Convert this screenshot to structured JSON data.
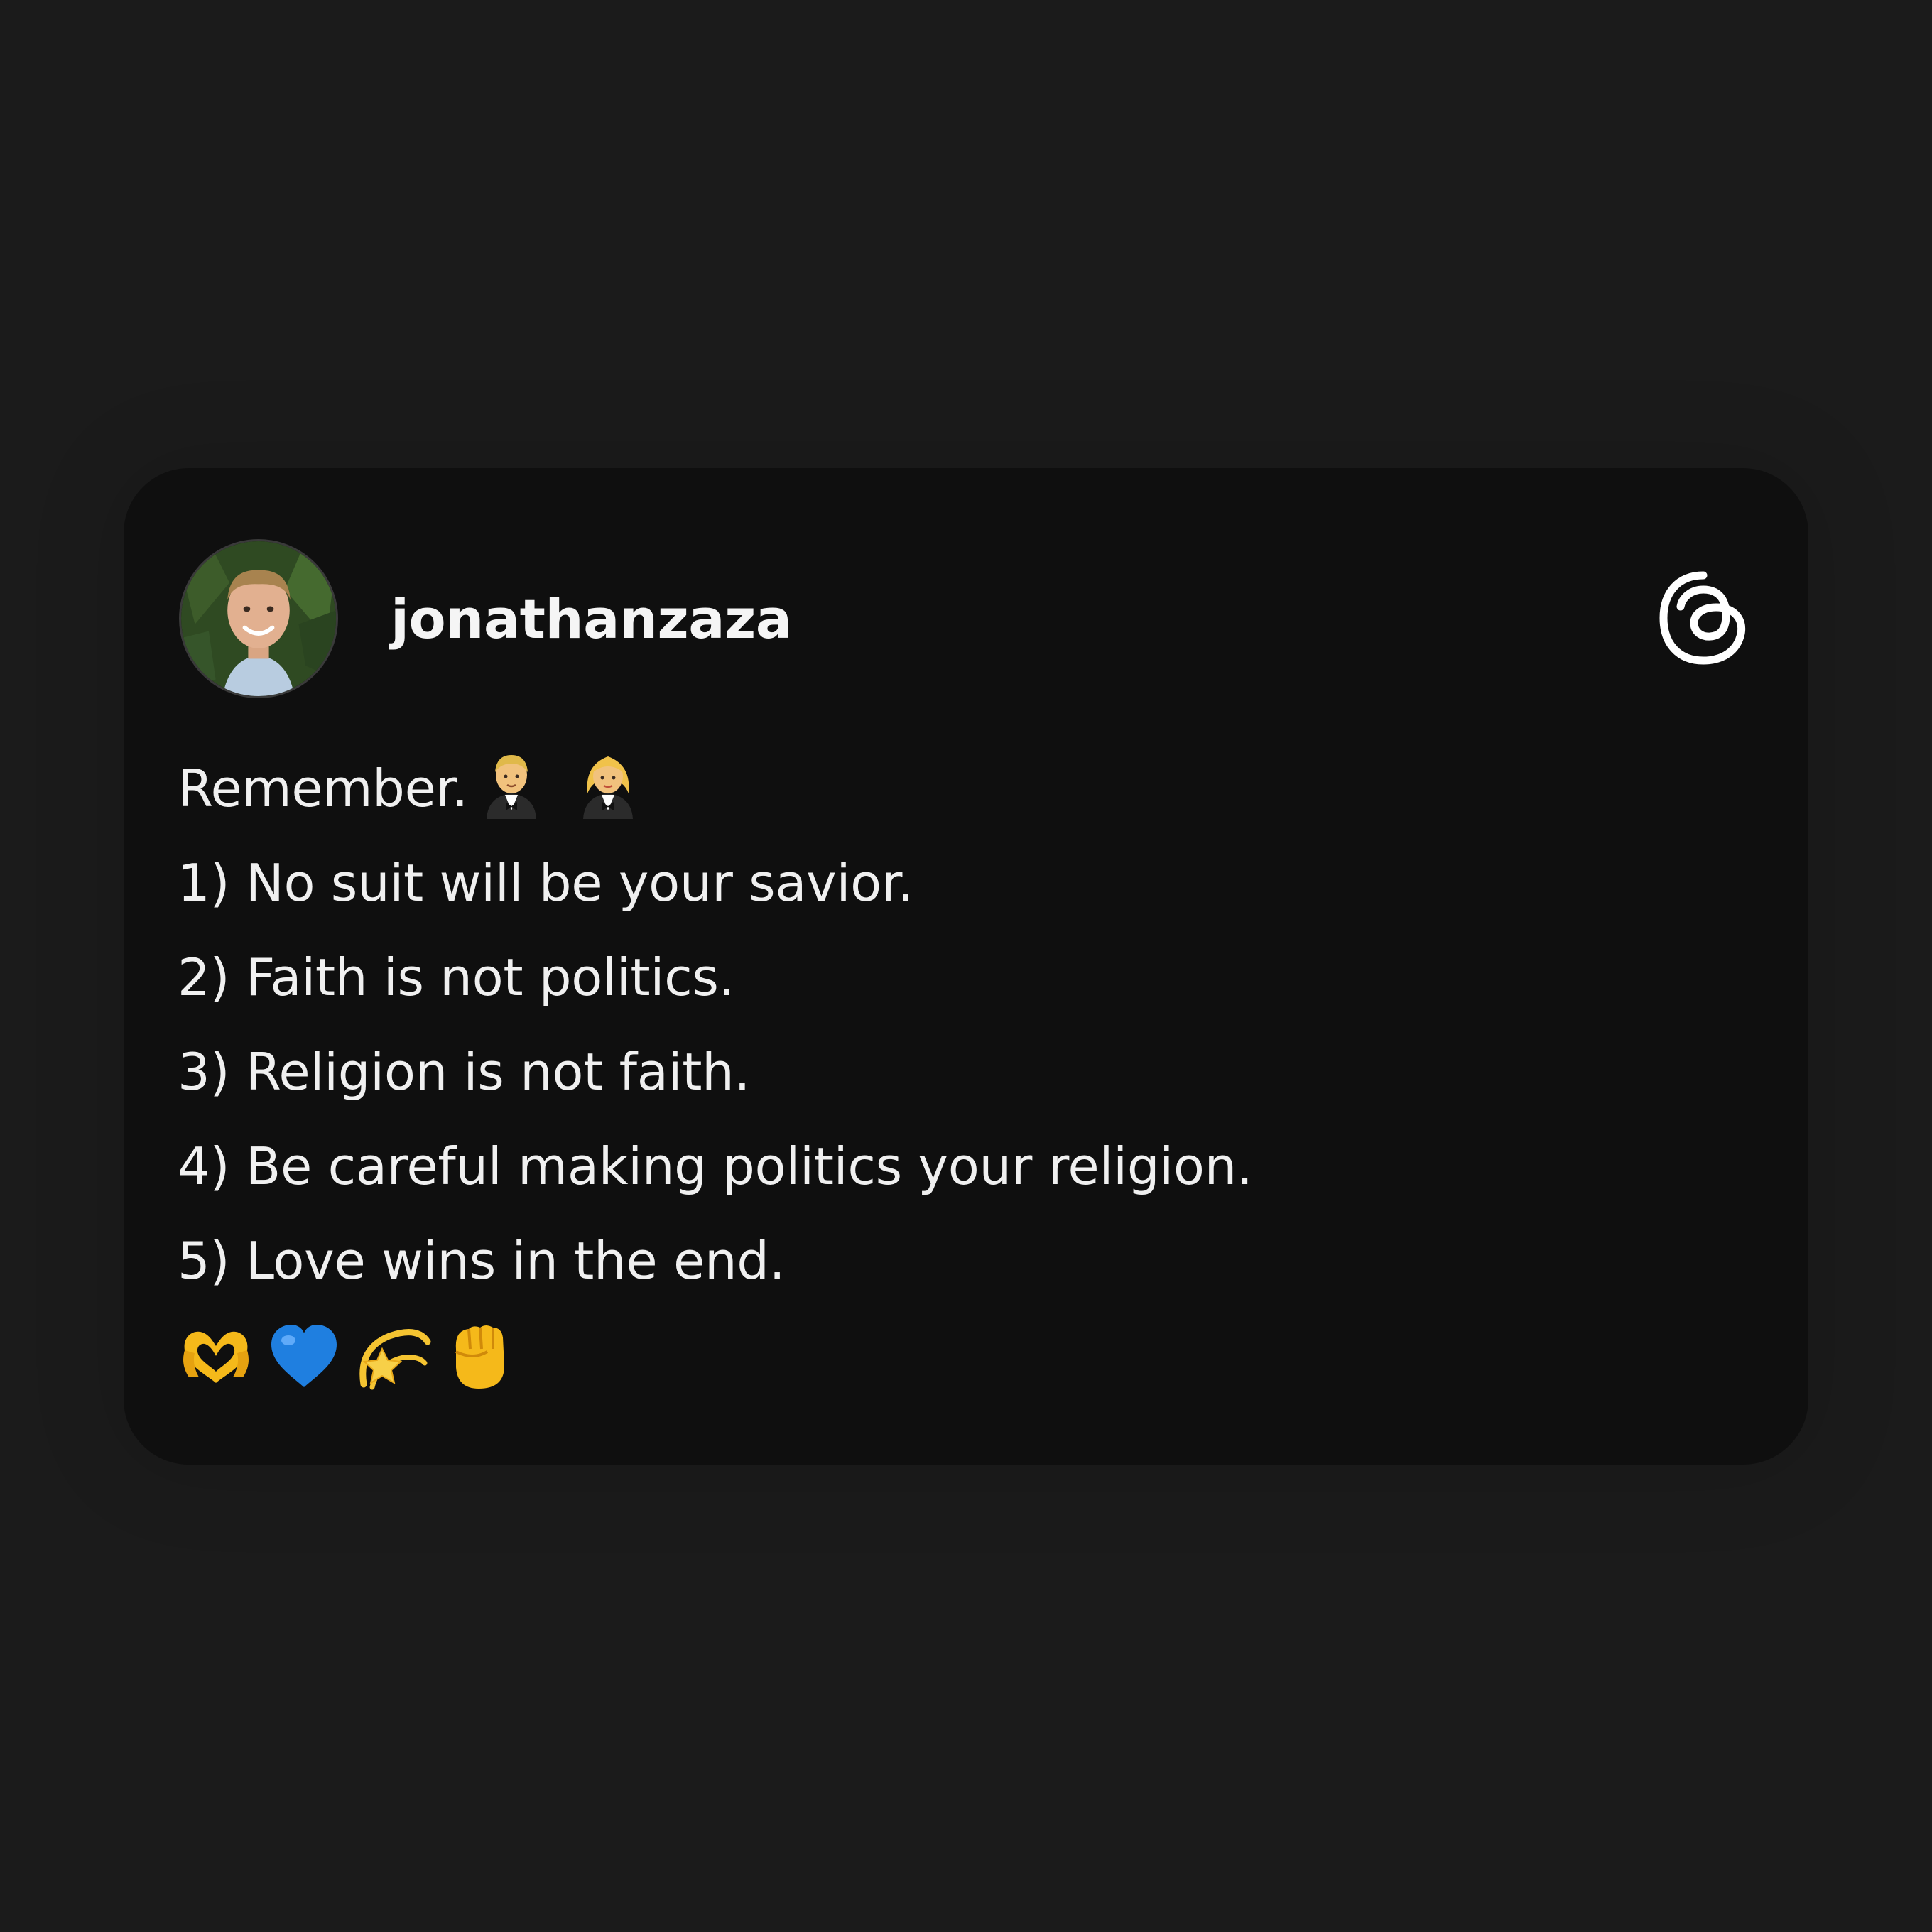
{
  "post": {
    "username": "jonathanzaza",
    "lines": [
      "Remember.",
      "1) No suit will be your savior.",
      "2) Faith is not politics.",
      "3) Religion is not faith.",
      "4) Be careful making politics your religion.",
      "5) Love wins in the end."
    ],
    "title_emojis": [
      "man-in-tuxedo-icon",
      "woman-in-tuxedo-icon"
    ],
    "footer_emojis": [
      "heart-hands-icon",
      "blue-heart-icon",
      "dizzy-star-icon",
      "raised-fist-icon"
    ]
  },
  "brand": {
    "logo": "threads-logo-icon"
  },
  "colors": {
    "page_background": "#1b1b1b",
    "card_background": "#0f0f0f",
    "text": "#f0f0f0"
  }
}
